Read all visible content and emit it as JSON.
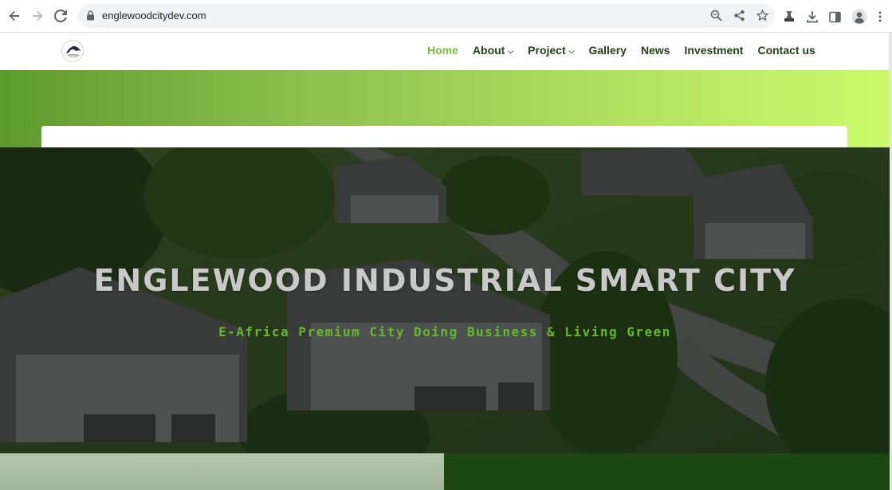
{
  "browser": {
    "url": "englewoodcitydev.com",
    "icons": {
      "back": "back-arrow-icon",
      "forward": "forward-arrow-icon",
      "reload": "reload-icon",
      "lock": "lock-icon",
      "zoom": "zoom-icon",
      "share": "share-icon",
      "bookmark": "star-icon",
      "extension": "flask-icon",
      "download": "download-icon",
      "sidepanel": "side-panel-icon",
      "profile": "profile-icon",
      "menu": "kebab-menu-icon"
    }
  },
  "site": {
    "nav": [
      {
        "label": "Home",
        "active": true
      },
      {
        "label": "About",
        "dropdown": true
      },
      {
        "label": "Project",
        "dropdown": true
      },
      {
        "label": "Gallery"
      },
      {
        "label": "News"
      },
      {
        "label": "Investment"
      },
      {
        "label": "Contact us"
      }
    ],
    "hero": {
      "title": "ENGLEWOOD INDUSTRIAL SMART CITY",
      "subtitle": "E-Africa Premium City Doing Business & Living Green"
    }
  },
  "colors": {
    "nav_text": "#1f4417",
    "nav_active": "#7cbd3f",
    "banner_start": "#5e9a2d",
    "banner_end": "#ccf96a",
    "hero_subtitle": "#66b82f",
    "footer_dark": "#1c4710"
  }
}
